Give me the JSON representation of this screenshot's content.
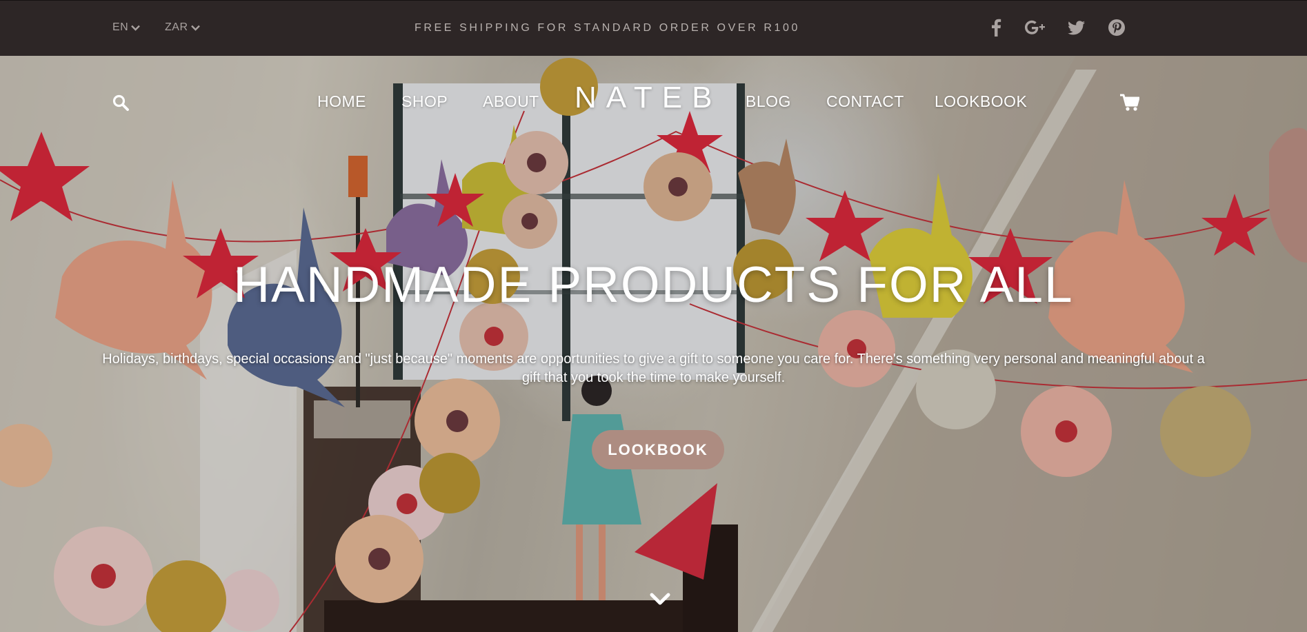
{
  "topbar": {
    "language": "EN",
    "currency": "ZAR",
    "shipping_text": "FREE SHIPPING FOR STANDARD ORDER OVER R100",
    "social_icons": [
      "facebook-icon",
      "google-plus-icon",
      "twitter-icon",
      "pinterest-icon"
    ]
  },
  "nav": {
    "logo": "NATEB",
    "left_items": [
      "HOME",
      "SHOP",
      "ABOUT"
    ],
    "right_items": [
      "BLOG",
      "CONTACT",
      "LOOKBOOK"
    ],
    "icons": [
      "search-icon",
      "cart-icon"
    ]
  },
  "hero": {
    "headline": "HANDMADE PRODUCTS FOR ALL",
    "subtext": "Holidays, birthdays, special occasions and \"just because\" moments are opportunities to give a gift to someone you care for. There's something very personal and meaningful about a gift that you took the time to make yourself.",
    "cta_label": "LOOKBOOK",
    "scroll_icon": "chevron-down-icon"
  },
  "colors": {
    "topbar_bg": "#2d2626",
    "topbar_text": "#a9a2a0",
    "cta_bg": "#ad8c81",
    "hero_text": "#ffffff"
  }
}
